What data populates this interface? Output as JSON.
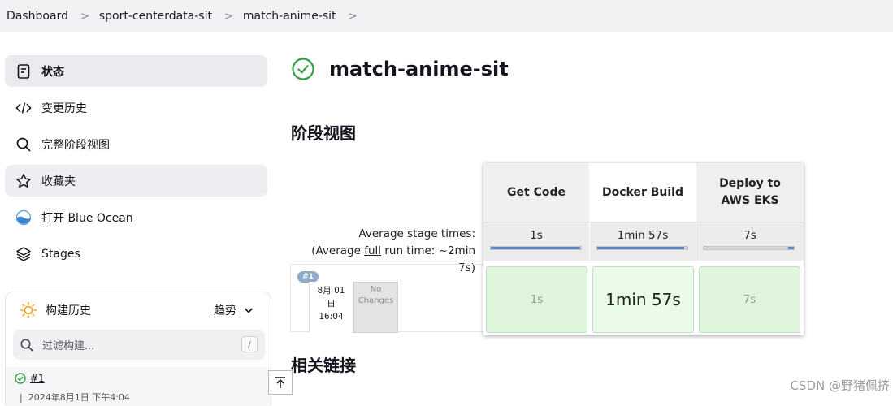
{
  "breadcrumb": [
    "Dashboard",
    "sport-centerdata-sit",
    "match-anime-sit"
  ],
  "sidebar": {
    "items": [
      {
        "label": "状态",
        "icon": "document-icon"
      },
      {
        "label": "变更历史",
        "icon": "code-icon"
      },
      {
        "label": "完整阶段视图",
        "icon": "search-icon"
      },
      {
        "label": "收藏夹",
        "icon": "star-icon"
      },
      {
        "label": "打开 Blue Ocean",
        "icon": "blue-ocean-icon"
      },
      {
        "label": "Stages",
        "icon": "layers-icon"
      }
    ]
  },
  "build_history": {
    "title": "构建历史",
    "trend_label": "趋势",
    "filter_placeholder": "过滤构建...",
    "filter_shortcut": "/",
    "builds": [
      {
        "number": "#1",
        "date": "2024年8月1日 下午4:04"
      }
    ]
  },
  "page": {
    "title": "match-anime-sit",
    "stage_view_heading": "阶段视图",
    "related_links_heading": "相关链接"
  },
  "stage_view": {
    "avg_label": "Average stage times:",
    "avg_full_prefix": "(Average",
    "avg_full_link": "full",
    "avg_full_suffix": "run time: ~2min",
    "avg_full_tail": "7s)",
    "run": {
      "badge": "#1",
      "date_line1": "8月 01",
      "date_line2": "日",
      "time": "16:04",
      "changes_line1": "No",
      "changes_line2": "Changes"
    },
    "stages": [
      {
        "name": "Get Code",
        "avg": "1s",
        "duration": "1s",
        "avg_fraction": 0.99
      },
      {
        "name": "Docker Build",
        "avg": "1min 57s",
        "duration": "1min 57s",
        "avg_fraction": 0.96
      },
      {
        "name": "Deploy to AWS EKS",
        "avg": "7s",
        "duration": "7s",
        "avg_fraction": 0.06
      }
    ]
  },
  "colors": {
    "success_green": "#2ea043",
    "stage_success_bg": "#dff5dc",
    "stage_active_bg": "#eafbe7",
    "progress_blue": "#5b87c7"
  },
  "watermark": "CSDN @野猪佩挤"
}
